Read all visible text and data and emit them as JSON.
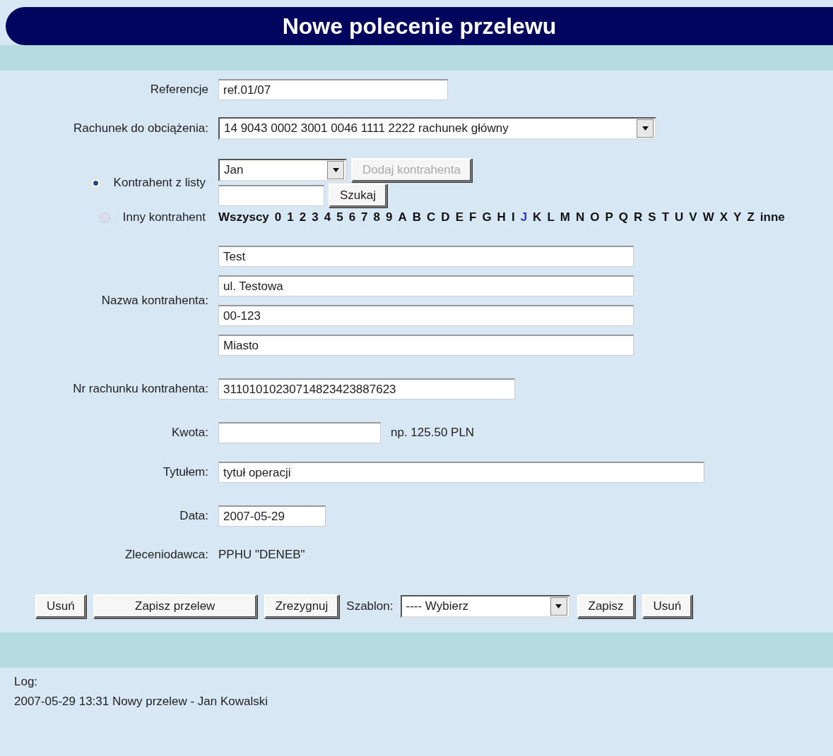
{
  "header": {
    "title": "Nowe polecenie przelewu"
  },
  "reference": {
    "label": "Referencje",
    "value": "ref.01/07"
  },
  "debit_account": {
    "label": "Rachunek do obciążenia:",
    "value": "14 9043 0002 3001 0046 1111 2222 rachunek główny"
  },
  "counterparty_mode": [
    {
      "label": "Kontrahent z listy",
      "selected": true
    },
    {
      "label": "Inny kontrahent",
      "selected": false
    }
  ],
  "counterparty_select": {
    "value": "Jan"
  },
  "add_button": {
    "label": "Dodaj kontrahenta",
    "disabled": true
  },
  "search_button": {
    "label": "Szukaj"
  },
  "letters": [
    {
      "label": "Wszyscy",
      "selected": false
    },
    {
      "label": "0",
      "selected": false
    },
    {
      "label": "1",
      "selected": false
    },
    {
      "label": "2",
      "selected": false
    },
    {
      "label": "3",
      "selected": false
    },
    {
      "label": "4",
      "selected": false
    },
    {
      "label": "5",
      "selected": false
    },
    {
      "label": "6",
      "selected": false
    },
    {
      "label": "7",
      "selected": false
    },
    {
      "label": "8",
      "selected": false
    },
    {
      "label": "9",
      "selected": false
    },
    {
      "label": "A",
      "selected": false
    },
    {
      "label": "B",
      "selected": false
    },
    {
      "label": "C",
      "selected": false
    },
    {
      "label": "D",
      "selected": false
    },
    {
      "label": "E",
      "selected": false
    },
    {
      "label": "F",
      "selected": false
    },
    {
      "label": "G",
      "selected": false
    },
    {
      "label": "H",
      "selected": false
    },
    {
      "label": "I",
      "selected": false
    },
    {
      "label": "J",
      "selected": true
    },
    {
      "label": "K",
      "selected": false
    },
    {
      "label": "L",
      "selected": false
    },
    {
      "label": "M",
      "selected": false
    },
    {
      "label": "N",
      "selected": false
    },
    {
      "label": "O",
      "selected": false
    },
    {
      "label": "P",
      "selected": false
    },
    {
      "label": "Q",
      "selected": false
    },
    {
      "label": "R",
      "selected": false
    },
    {
      "label": "S",
      "selected": false
    },
    {
      "label": "T",
      "selected": false
    },
    {
      "label": "U",
      "selected": false
    },
    {
      "label": "V",
      "selected": false
    },
    {
      "label": "W",
      "selected": false
    },
    {
      "label": "X",
      "selected": false
    },
    {
      "label": "Y",
      "selected": false
    },
    {
      "label": "Z",
      "selected": false
    },
    {
      "label": "inne",
      "selected": false
    }
  ],
  "counterparty_name": {
    "label": "Nazwa kontrahenta:",
    "lines": [
      "Test",
      "ul. Testowa",
      "00-123",
      "Miasto"
    ]
  },
  "account_number": {
    "label": "Nr rachunku kontrahenta:",
    "value": "31101010230714823423887623"
  },
  "amount": {
    "label": "Kwota:",
    "hint": "np. 125.50 PLN"
  },
  "title": {
    "label": "Tytułem:",
    "value": "tytuł operacji"
  },
  "date": {
    "label": "Data:",
    "value": "2007-05-29"
  },
  "ordering_party": {
    "label": "Zleceniodawca:",
    "value": "PPHU \"DENEB\""
  },
  "actions": {
    "delete": "Usuń",
    "save_transfer": "Zapisz przelew",
    "cancel": "Zrezygnuj",
    "template_label": "Szablon:",
    "template_value": "---- Wybierz",
    "save": "Zapisz",
    "delete_template": "Usuń"
  },
  "log": {
    "label": "Log:",
    "entries": [
      "2007-05-29 13:31 Nowy przelew - Jan Kowalski"
    ]
  }
}
